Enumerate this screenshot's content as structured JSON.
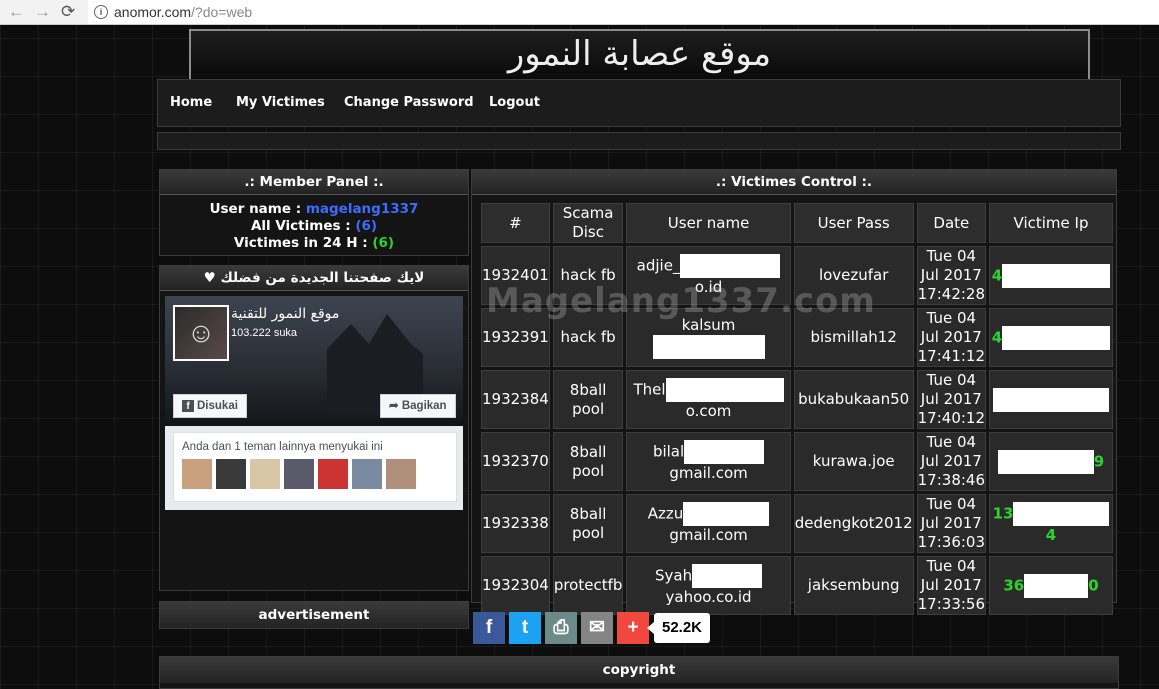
{
  "browser": {
    "back_icon": "←",
    "forward_icon": "→",
    "reload_icon": "⟳",
    "url_host": "anomor.com",
    "url_path": "/?do=web"
  },
  "banner": {
    "title": "موقع عصابة النمور"
  },
  "nav": {
    "home": "Home",
    "my_victims": "My Victimes",
    "change_password": "Change Password",
    "logout": "Logout"
  },
  "member_panel": {
    "title": ".: Member Panel :.",
    "username_label": "User name : ",
    "username_value": "magelang1337",
    "all_victims_label": "All Victimes : ",
    "all_victims_value": "(6)",
    "victims_24h_label": "Victimes in 24 H : ",
    "victims_24h_value": "(6)"
  },
  "like_panel": {
    "title": "♥ لايك صفحتنا الجديدة من فضلك",
    "page_name": "موقع النمور للتقنية",
    "likes": "103.222 suka",
    "liked_button": "Disukai",
    "share_button": "Bagikan",
    "friends_text": "Anda dan 1 teman lainnya menyukai ini"
  },
  "ad_panel": {
    "title": "advertisement"
  },
  "copyright_panel": {
    "title": "copyright"
  },
  "victims": {
    "title": ".: Victimes Control :.",
    "headers": [
      "#",
      "Scama Disc",
      "User name",
      "User Pass",
      "Date",
      "Victime Ip"
    ],
    "rows": [
      {
        "id": "1932401",
        "scama": "hack fb",
        "user_pre": "adjie_",
        "user_post": "o.id",
        "pass": "lovezufar",
        "date": "Tue 04 Jul 2017 17:42:28",
        "ip_pre": "4",
        "ip_post": ""
      },
      {
        "id": "1932391",
        "scama": "hack fb",
        "user_pre": "kalsum",
        "user_post": "",
        "pass": "bismillah12",
        "date": "Tue 04 Jul 2017 17:41:12",
        "ip_pre": "4",
        "ip_post": ""
      },
      {
        "id": "1932384",
        "scama": "8ball pool",
        "user_pre": "Thel",
        "user_post": "o.com",
        "pass": "bukabukaan50",
        "date": "Tue 04 Jul 2017 17:40:12",
        "ip_pre": "",
        "ip_post": ""
      },
      {
        "id": "1932370",
        "scama": "8ball pool",
        "user_pre": "bilal",
        "user_post": "gmail.com",
        "pass": "kurawa.joe",
        "date": "Tue 04 Jul 2017 17:38:46",
        "ip_pre": "",
        "ip_post": "9"
      },
      {
        "id": "1932338",
        "scama": "8ball pool",
        "user_pre": "Azzu",
        "user_post": "gmail.com",
        "pass": "dedengkot2012",
        "date": "Tue 04 Jul 2017 17:36:03",
        "ip_pre": "13",
        "ip_post": "4"
      },
      {
        "id": "1932304",
        "scama": "protectfb",
        "user_pre": "Syah",
        "user_post": "yahoo.co.id",
        "pass": "jaksembung",
        "date": "Tue 04 Jul 2017 17:33:56",
        "ip_pre": "36",
        "ip_post": "0"
      }
    ]
  },
  "watermark": "Magelang1337.com",
  "share": {
    "facebook_glyph": "f",
    "twitter_glyph": "t",
    "print_glyph": "⎙",
    "email_glyph": "✉",
    "more_glyph": "+",
    "count": "52.2K",
    "colors": {
      "facebook": "#3b5998",
      "twitter": "#1da1f2",
      "print": "#6d8a8a",
      "email": "#848484",
      "more": "#f0483e"
    }
  }
}
